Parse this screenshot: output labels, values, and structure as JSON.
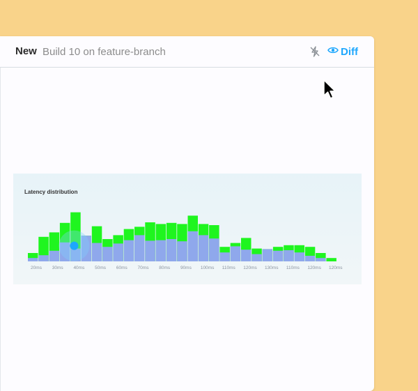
{
  "header": {
    "status": "New",
    "build_label": "Build 10 on feature-branch",
    "diff_label": "Diff",
    "flash_icon": "lightning-off-icon",
    "diff_icon": "eye-icon"
  },
  "colors": {
    "background": "#f9d38a",
    "accent": "#1ea7fd",
    "baseline_bar": "#8fa8ec",
    "diff_highlight": "#1ff51f"
  },
  "chart_data": {
    "type": "bar",
    "title": "Latency distribution",
    "x_tick_labels": [
      "20ms",
      "30ms",
      "40ms",
      "50ms",
      "60ms",
      "70ms",
      "80ms",
      "90ms",
      "100ms",
      "110ms",
      "120ms",
      "130ms",
      "110ms",
      "120ms",
      "120ms"
    ],
    "series": [
      {
        "values": [
          6,
          11,
          19,
          34,
          23,
          46,
          33,
          26,
          32,
          38,
          47,
          37,
          38,
          40,
          36,
          54,
          47,
          41,
          16,
          27,
          21,
          13,
          22,
          19,
          20,
          16,
          10,
          6
        ]
      },
      {
        "values": [
          15,
          44,
          52,
          69,
          88,
          46,
          63,
          40,
          47,
          58,
          62,
          70,
          67,
          69,
          67,
          82,
          67,
          65,
          26,
          33,
          42,
          23,
          22,
          26,
          29,
          29,
          26,
          15,
          6
        ]
      }
    ],
    "hover_index": 4,
    "ylim": [
      0,
      100
    ]
  }
}
